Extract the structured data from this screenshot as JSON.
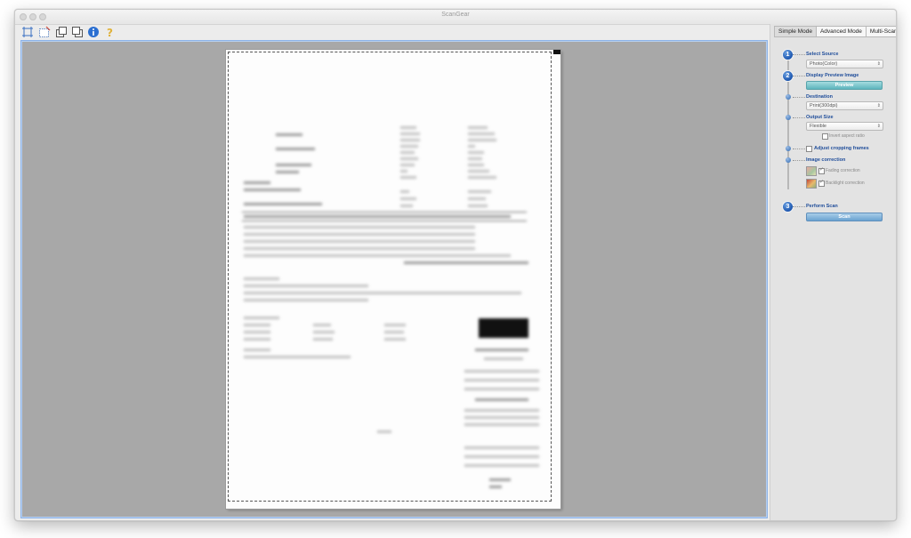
{
  "window": {
    "title": "ScanGear"
  },
  "toolbar": {
    "items": [
      {
        "icon": "auto-crop-icon"
      },
      {
        "icon": "remove-crop-icon"
      },
      {
        "icon": "rotate-left-icon"
      },
      {
        "icon": "rotate-right-icon"
      },
      {
        "icon": "info-icon"
      },
      {
        "icon": "help-icon"
      }
    ]
  },
  "tabs": [
    "Simple Mode",
    "Advanced Mode",
    "Multi-Scan"
  ],
  "steps": {
    "select_source": {
      "number": "1",
      "label": "Select Source",
      "value": "Photo(Color)"
    },
    "display_preview": {
      "number": "2",
      "label": "Display Preview Image",
      "button": "Preview"
    },
    "destination": {
      "label": "Destination",
      "value": "Print(300dpi)"
    },
    "output_size": {
      "label": "Output Size",
      "value": "Flexible",
      "invert_label": "Invert aspect ratio"
    },
    "adjust_crop": {
      "label": "Adjust cropping frames"
    },
    "image_correction": {
      "label": "Image correction",
      "fading": "Fading correction",
      "backlight": "Backlight correction"
    },
    "perform_scan": {
      "number": "3",
      "label": "Perform Scan",
      "button": "Scan"
    }
  },
  "colors": {
    "accent": "#1f4d9a",
    "preview_bg": "#a8a8a8",
    "circle": "#1d57b0"
  }
}
